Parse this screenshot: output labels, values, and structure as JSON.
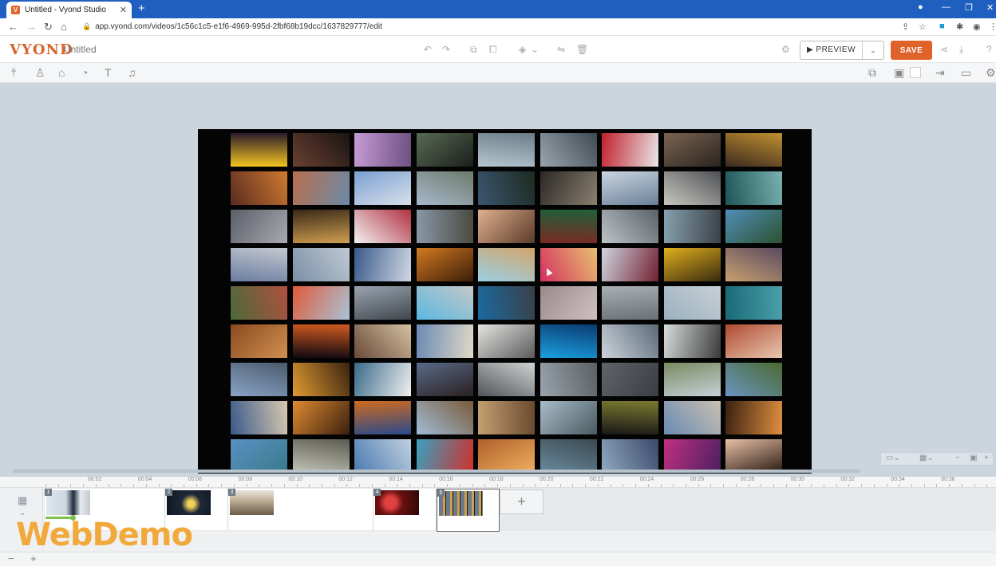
{
  "browser": {
    "tab_title": "Untitled - Vyond Studio",
    "tab_close": "✕",
    "new_tab": "+",
    "url": "app.vyond.com/videos/1c56c1c5-e1f6-4969-995d-2fbf68b19dcc/1637829777/edit",
    "favicon_letter": "V"
  },
  "app": {
    "logo": "VYOND",
    "doc_title": "Untitled",
    "preview_label": "▶ PREVIEW",
    "save_label": "SAVE"
  },
  "timeline": {
    "ticks": [
      "00:02",
      "00:04",
      "00:06",
      "00:08",
      "00:10",
      "00:12",
      "00:14",
      "00:16",
      "00:18",
      "00:20",
      "00:22",
      "00:24",
      "00:26",
      "00:28",
      "00:30",
      "00:32",
      "00:34",
      "00:36"
    ],
    "scenes": [
      {
        "num": "1"
      },
      {
        "num": "2"
      },
      {
        "num": "3"
      },
      {
        "num": "4"
      },
      {
        "num": "5"
      }
    ],
    "add_scene": "+",
    "zoom_out": "−",
    "zoom_in": "+"
  },
  "watermark": "WebDemo",
  "photo_palettes": [
    [
      "#f4c51f",
      "#2a1c2a"
    ],
    [
      "#6a4030",
      "#1a1414"
    ],
    [
      "#c79bd6",
      "#6d5080"
    ],
    [
      "#586a56",
      "#1c1f1a"
    ],
    [
      "#b8c6d0",
      "#6a7d88"
    ],
    [
      "#9aa6ae",
      "#404a52"
    ],
    [
      "#c21f2d",
      "#e8e8e8"
    ],
    [
      "#7a6450",
      "#2b2420"
    ],
    [
      "#3b2a20",
      "#c0902f"
    ],
    [
      "#5a2c20",
      "#d07a30"
    ],
    [
      "#b86f4e",
      "#6a8aa8"
    ],
    [
      "#7ba0d2",
      "#d8e0ea"
    ],
    [
      "#a7b8cc",
      "#6c7b6a"
    ],
    [
      "#3a5670",
      "#1d2a20"
    ],
    [
      "#2b2826",
      "#8a8070"
    ],
    [
      "#c9d5e2",
      "#6b8097"
    ],
    [
      "#c8c7c0",
      "#4f5155"
    ],
    [
      "#1d5558",
      "#7ab0b0"
    ],
    [
      "#5a5e67",
      "#a8aab0"
    ],
    [
      "#3a2818",
      "#d0a050"
    ],
    [
      "#f3f3f3",
      "#b03040"
    ],
    [
      "#8a98a8",
      "#4a4a40"
    ],
    [
      "#e0b090",
      "#5a3a28"
    ],
    [
      "#7a2a24",
      "#20603a"
    ],
    [
      "#bcc4c8",
      "#5a6168"
    ],
    [
      "#86a0b0",
      "#3b4246"
    ],
    [
      "#4f8fb8",
      "#2d5030"
    ],
    [
      "#6a7da0",
      "#c4c8d0"
    ],
    [
      "#7a8fa6",
      "#bfc9d4"
    ],
    [
      "#3a5a8a",
      "#d0d8e4"
    ],
    [
      "#d47a20",
      "#3a1e0a"
    ],
    [
      "#9ad0e4",
      "#d4a46c"
    ],
    [
      "#d43060",
      "#e8c070"
    ],
    [
      "#d0d4e0",
      "#702030"
    ],
    [
      "#e0b01c",
      "#3a2a10"
    ],
    [
      "#c8a070",
      "#5a4a60"
    ],
    [
      "#4a6a38",
      "#b05040"
    ],
    [
      "#e05a3a",
      "#a8c4d8"
    ],
    [
      "#9aa4b0",
      "#40464c"
    ],
    [
      "#5ab8e0",
      "#c4c8c8"
    ],
    [
      "#1a6aa0",
      "#3a4048"
    ],
    [
      "#9a8a8c",
      "#d0c0c4"
    ],
    [
      "#a8b0b4",
      "#6a7074"
    ],
    [
      "#9ab0c0",
      "#c8d0d4"
    ],
    [
      "#1a6a78",
      "#4aa0a8"
    ],
    [
      "#8a4a20",
      "#d09050"
    ],
    [
      "#100810",
      "#d05a20"
    ],
    [
      "#6a4a3a",
      "#d4c0a0"
    ],
    [
      "#6a8ab4",
      "#e0d8c8"
    ],
    [
      "#e4e4e2",
      "#5a5a5a"
    ],
    [
      "#1aa0e0",
      "#0a3a70"
    ],
    [
      "#cdd4da",
      "#5a6a7a"
    ],
    [
      "#d8dcdc",
      "#3a3a3a"
    ],
    [
      "#b04a30",
      "#e8c8b0"
    ],
    [
      "#8aa4c8",
      "#4a5a6a"
    ],
    [
      "#e09a30",
      "#3a2410"
    ],
    [
      "#3a6a8a",
      "#f0f0f0"
    ],
    [
      "#5a6a8a",
      "#2a2020"
    ],
    [
      "#505458",
      "#d0d4d4"
    ],
    [
      "#9aa4ac",
      "#5a6064"
    ],
    [
      "#606468",
      "#3a3e42"
    ],
    [
      "#7a8a60",
      "#c4d0d8"
    ],
    [
      "#6a94c0",
      "#4a6a30"
    ],
    [
      "#3a5a8a",
      "#d8c8b0"
    ],
    [
      "#e08a30",
      "#3a2010"
    ],
    [
      "#d06a20",
      "#2a4a8a"
    ],
    [
      "#a0bcd8",
      "#7a5a3a"
    ],
    [
      "#c4a070",
      "#6a4a30"
    ],
    [
      "#a8bcc8",
      "#4a5a60"
    ],
    [
      "#1a1818",
      "#7a7a30"
    ],
    [
      "#6a8ab4",
      "#c8c0b0"
    ],
    [
      "#3a2010",
      "#e09040"
    ],
    [
      "#5a90c4",
      "#3a7a8a"
    ],
    [
      "#c4c4b8",
      "#5a5a50"
    ],
    [
      "#4a7ab0",
      "#c0d0e0"
    ],
    [
      "#3aa0c0",
      "#d0302a"
    ],
    [
      "#b0602a",
      "#f0b060"
    ],
    [
      "#6a8aa0",
      "#3a4a50"
    ],
    [
      "#90a8c0",
      "#3a4a6a"
    ],
    [
      "#c03080",
      "#4a2060"
    ],
    [
      "#e8c0a8",
      "#2a1a10"
    ]
  ]
}
